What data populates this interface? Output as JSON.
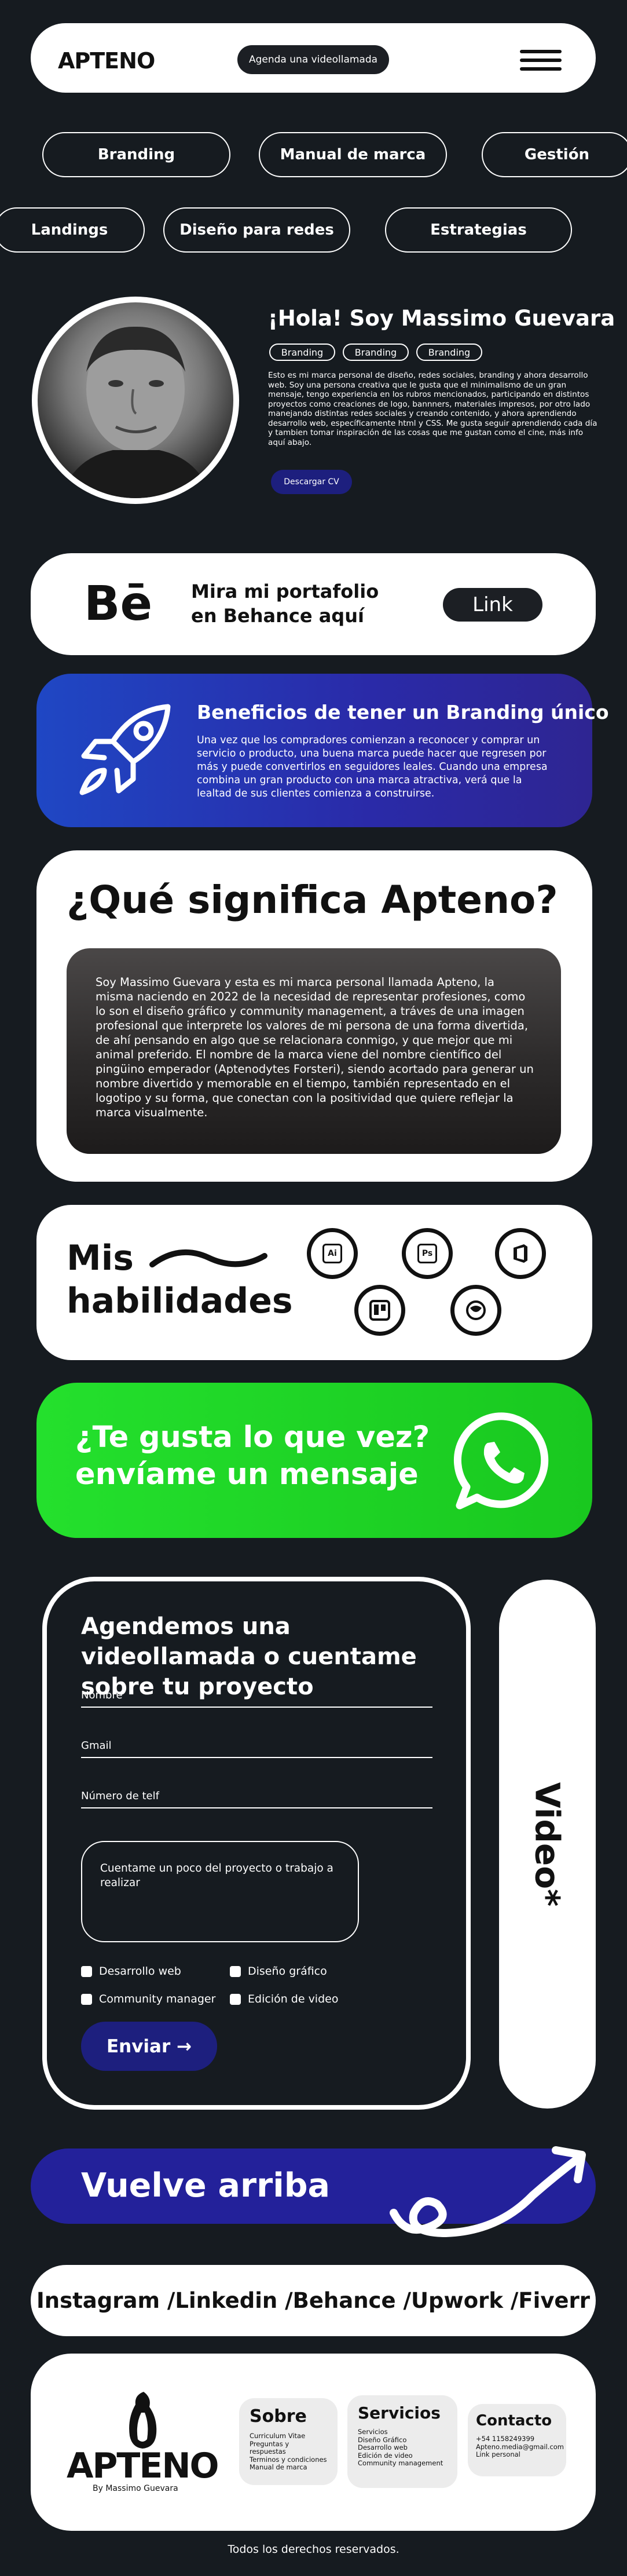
{
  "header": {
    "logo": "APTENO",
    "cta": "Agenda una videollamada"
  },
  "chips": {
    "row1": [
      "Branding",
      "Manual de marca",
      "Gestión"
    ],
    "row2": [
      "Landings",
      "Diseño para redes",
      "Estrategias"
    ]
  },
  "profile": {
    "greeting": "¡Hola! Soy Massimo Guevara",
    "tags": [
      "Branding",
      "Branding",
      "Branding"
    ],
    "bio": "Esto es mi marca personal de diseño, redes sociales, branding y ahora desarrollo web. Soy una persona creativa que le gusta que el minimalismo de un gran mensaje, tengo experiencia en los rubros mencionados, participando en distintos proyectos como creaciones de logo, bannners, materiales impresos, por otro lado manejando distintas redes sociales y creando contenido, y ahora aprendiendo desarrollo web, específicamente html y CSS. Me gusta seguir aprendiendo cada día y tambien tomar inspiración de las cosas que me gustan como el cine, más info aquí abajo.",
    "cv_button": "Descargar CV"
  },
  "behance": {
    "logo": "Bē",
    "text": "Mira mi portafolio en Behance aquí",
    "link": "Link"
  },
  "benefits": {
    "title": "Beneficios de tener un Branding único",
    "text": "Una vez que los compradores comienzan  a reconocer y comprar un servicio o producto, una buena marca puede hacer que regresen por más y puede convertirlos en seguidores leales. Cuando una empresa combina un gran producto con una marca atractiva, verá que la lealtad de sus clientes comienza a construirse."
  },
  "meaning": {
    "title": "¿Qué significa Apteno?",
    "text": "Soy Massimo Guevara y esta es mi marca personal llamada Apteno, la misma naciendo en 2022 de la necesidad de representar profesiones, como lo son el diseño gráfico y community management, a tráves de una imagen profesional que interprete los valores de mi persona de una forma divertida, de ahí pensando en algo que se relacionara conmigo, y que mejor que mi animal preferido. El nombre de la marca viene del nombre científico del pingüino emperador (Aptenodytes Forsteri), siendo acortado para generar un nombre divertido y memorable en el tiempo, también representado en el logotipo y su forma, que conectan con la positividad que quiere reflejar la marca visualmente."
  },
  "skills": {
    "title_line1": "Mis",
    "title_line2": "habilidades",
    "icons": [
      "Ai",
      "Ps",
      "office",
      "trello",
      "community"
    ]
  },
  "whatsapp": {
    "text": "¿Te gusta lo que vez? envíame un mensaje"
  },
  "form": {
    "title": "Agendemos una videollamada o cuentame sobre tu proyecto",
    "name_label": "Nombre",
    "email_label": "Gmail",
    "phone_label": "Número de telf",
    "message_placeholder": "Cuentame un poco del proyecto o trabajo a realizar",
    "options": [
      "Desarrollo web",
      "Diseño gráfico",
      "Community manager",
      "Edición de video"
    ],
    "send": "Enviar →"
  },
  "video_label": "Video*",
  "back_to_top": "Vuelve arriba",
  "socials": "Instagram /Linkedin /Behance /Upwork /Fiverr",
  "footer": {
    "logo": "APTENO",
    "sub": "By Massimo Guevara",
    "col1_title": "Sobre",
    "col1_items": [
      "Curriculum Vitae",
      "Preguntas y respuestas",
      "Terminos y condiciones",
      "Manual de marca"
    ],
    "col2_title": "Servicios",
    "col2_items": [
      "Servicios",
      "Diseño Gráfico",
      "Desarrollo web",
      "Edición de video",
      "Community management"
    ],
    "col3_title": "Contacto",
    "col3_items": [
      "+54 1158249399",
      "Apteno.media@gmail.com",
      "Link personal"
    ],
    "copyright": "Todos los derechos reservados."
  },
  "colors": {
    "background": "#161b20",
    "accent_blue": "#23219a",
    "whatsapp_green": "#1fd426"
  }
}
